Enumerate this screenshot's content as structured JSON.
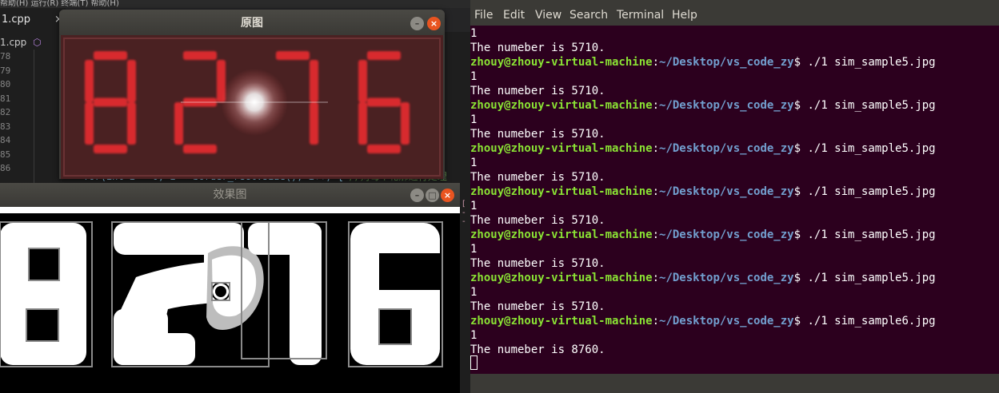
{
  "editor": {
    "topbar_text": "帮助(H)  运行(R)  终端(T)  帮助(H)",
    "tab_label": "1.cpp",
    "tab_close": "×",
    "breadcrumb_file": "1.cpp",
    "breadcrumb_symbol": "⬡",
    "line_numbers": [
      "78",
      "79",
      "80",
      "81",
      "82",
      "83",
      "84",
      "85",
      "86"
    ],
    "code_prefix": "for(int i = 0; i < border_rect.size(); i++) {",
    "code_comment": "//对每个轮廓进行处理",
    "side_marks": [
      "[",
      "-",
      "-"
    ]
  },
  "window_original": {
    "title": "原图",
    "min_glyph": "–",
    "close_glyph": "×",
    "digits": "8276",
    "colors": {
      "digit": "#d82a2f",
      "background": "#4a2122"
    }
  },
  "window_result": {
    "title": "效果图",
    "min_glyph": "–",
    "max_glyph": "□",
    "close_glyph": "×",
    "digit_color": "#ffffff",
    "box_color": "#8a8a8a"
  },
  "terminal": {
    "menu": [
      "File",
      "Edit",
      "View",
      "Search",
      "Terminal",
      "Help"
    ],
    "prompt_user": "zhouy@zhouy-virtual-machine",
    "prompt_path": "~/Desktop/vs_code_zy",
    "lines": [
      {
        "kind": "out",
        "text": "1"
      },
      {
        "kind": "out",
        "text": "The numeber is 5710."
      },
      {
        "kind": "cmd",
        "text": " ./1 sim_sample5.jpg"
      },
      {
        "kind": "out",
        "text": "1"
      },
      {
        "kind": "out",
        "text": "The numeber is 5710."
      },
      {
        "kind": "cmd",
        "text": " ./1 sim_sample5.jpg"
      },
      {
        "kind": "out",
        "text": "1"
      },
      {
        "kind": "out",
        "text": "The numeber is 5710."
      },
      {
        "kind": "cmd",
        "text": " ./1 sim_sample5.jpg"
      },
      {
        "kind": "out",
        "text": "1"
      },
      {
        "kind": "out",
        "text": "The numeber is 5710."
      },
      {
        "kind": "cmd",
        "text": " ./1 sim_sample5.jpg"
      },
      {
        "kind": "out",
        "text": "1"
      },
      {
        "kind": "out",
        "text": "The numeber is 5710."
      },
      {
        "kind": "cmd",
        "text": " ./1 sim_sample5.jpg"
      },
      {
        "kind": "out",
        "text": "1"
      },
      {
        "kind": "out",
        "text": "The numeber is 5710."
      },
      {
        "kind": "cmd",
        "text": " ./1 sim_sample5.jpg"
      },
      {
        "kind": "out",
        "text": "1"
      },
      {
        "kind": "out",
        "text": "The numeber is 5710."
      },
      {
        "kind": "cmd",
        "text": " ./1 sim_sample6.jpg"
      },
      {
        "kind": "out",
        "text": "1"
      },
      {
        "kind": "out",
        "text": "The numeber is 8760."
      }
    ],
    "colors": {
      "background": "#2c001e",
      "user": "#8ae234",
      "path": "#729fcf"
    }
  }
}
